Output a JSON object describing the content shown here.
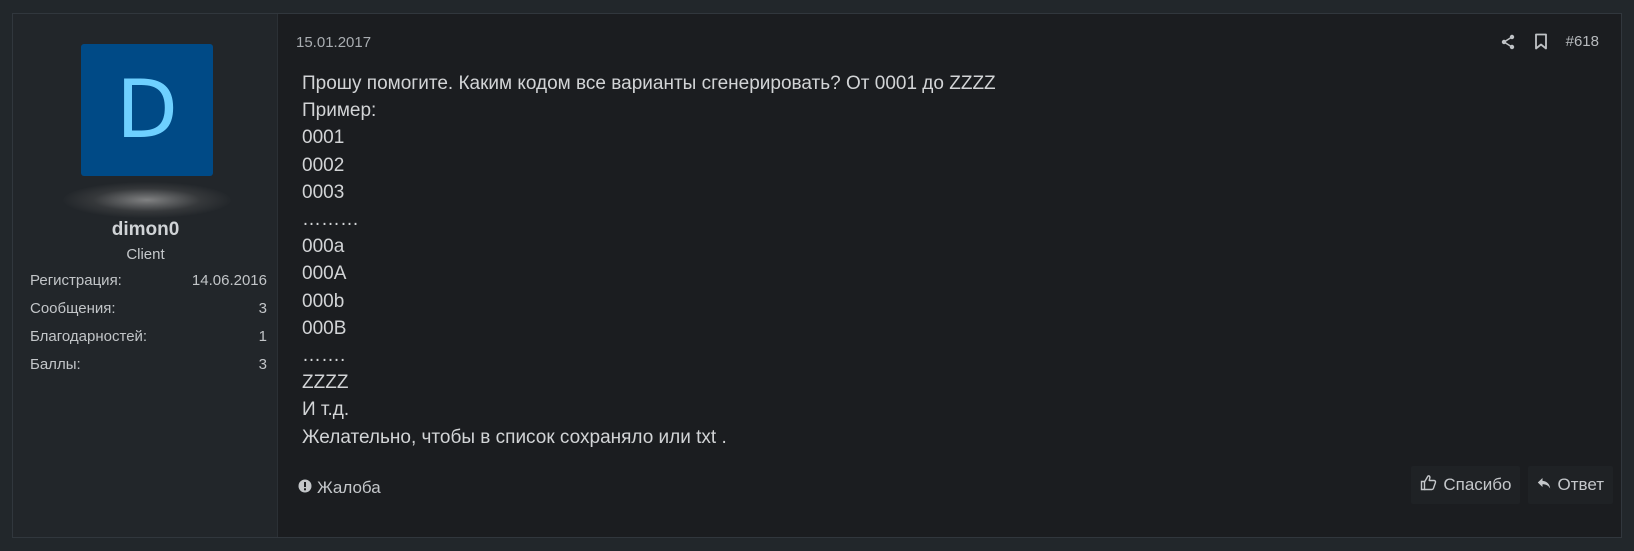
{
  "user": {
    "avatar_letter": "D",
    "username": "dimon0",
    "title": "Client",
    "stats": [
      {
        "label": "Регистрация:",
        "value": "14.06.2016"
      },
      {
        "label": "Сообщения:",
        "value": "3"
      },
      {
        "label": "Благодарностей:",
        "value": "1"
      },
      {
        "label": "Баллы:",
        "value": "3"
      }
    ]
  },
  "post": {
    "date": "15.01.2017",
    "number": "#618",
    "lines": [
      "Прошу помогите. Каким кодом все варианты сгенерировать? От 0001 до ZZZZ",
      "Пример:",
      "0001",
      "0002",
      "0003",
      "………",
      "000a",
      "000A",
      "000b",
      "000B",
      "…….",
      "ZZZZ",
      "И т.д.",
      "Желательно, чтобы в список сохраняло или txt ."
    ]
  },
  "footer": {
    "report_label": "Жалоба",
    "like_label": "Спасибо",
    "reply_label": "Ответ"
  },
  "colors": {
    "avatar_bg": "#004a86",
    "avatar_letter": "#6ed0ff",
    "page_bg": "#22272b",
    "post_bg": "#1b1d20"
  },
  "icons": [
    "share-icon",
    "bookmark-icon",
    "warning-icon",
    "thumbs-up-icon",
    "reply-icon"
  ]
}
